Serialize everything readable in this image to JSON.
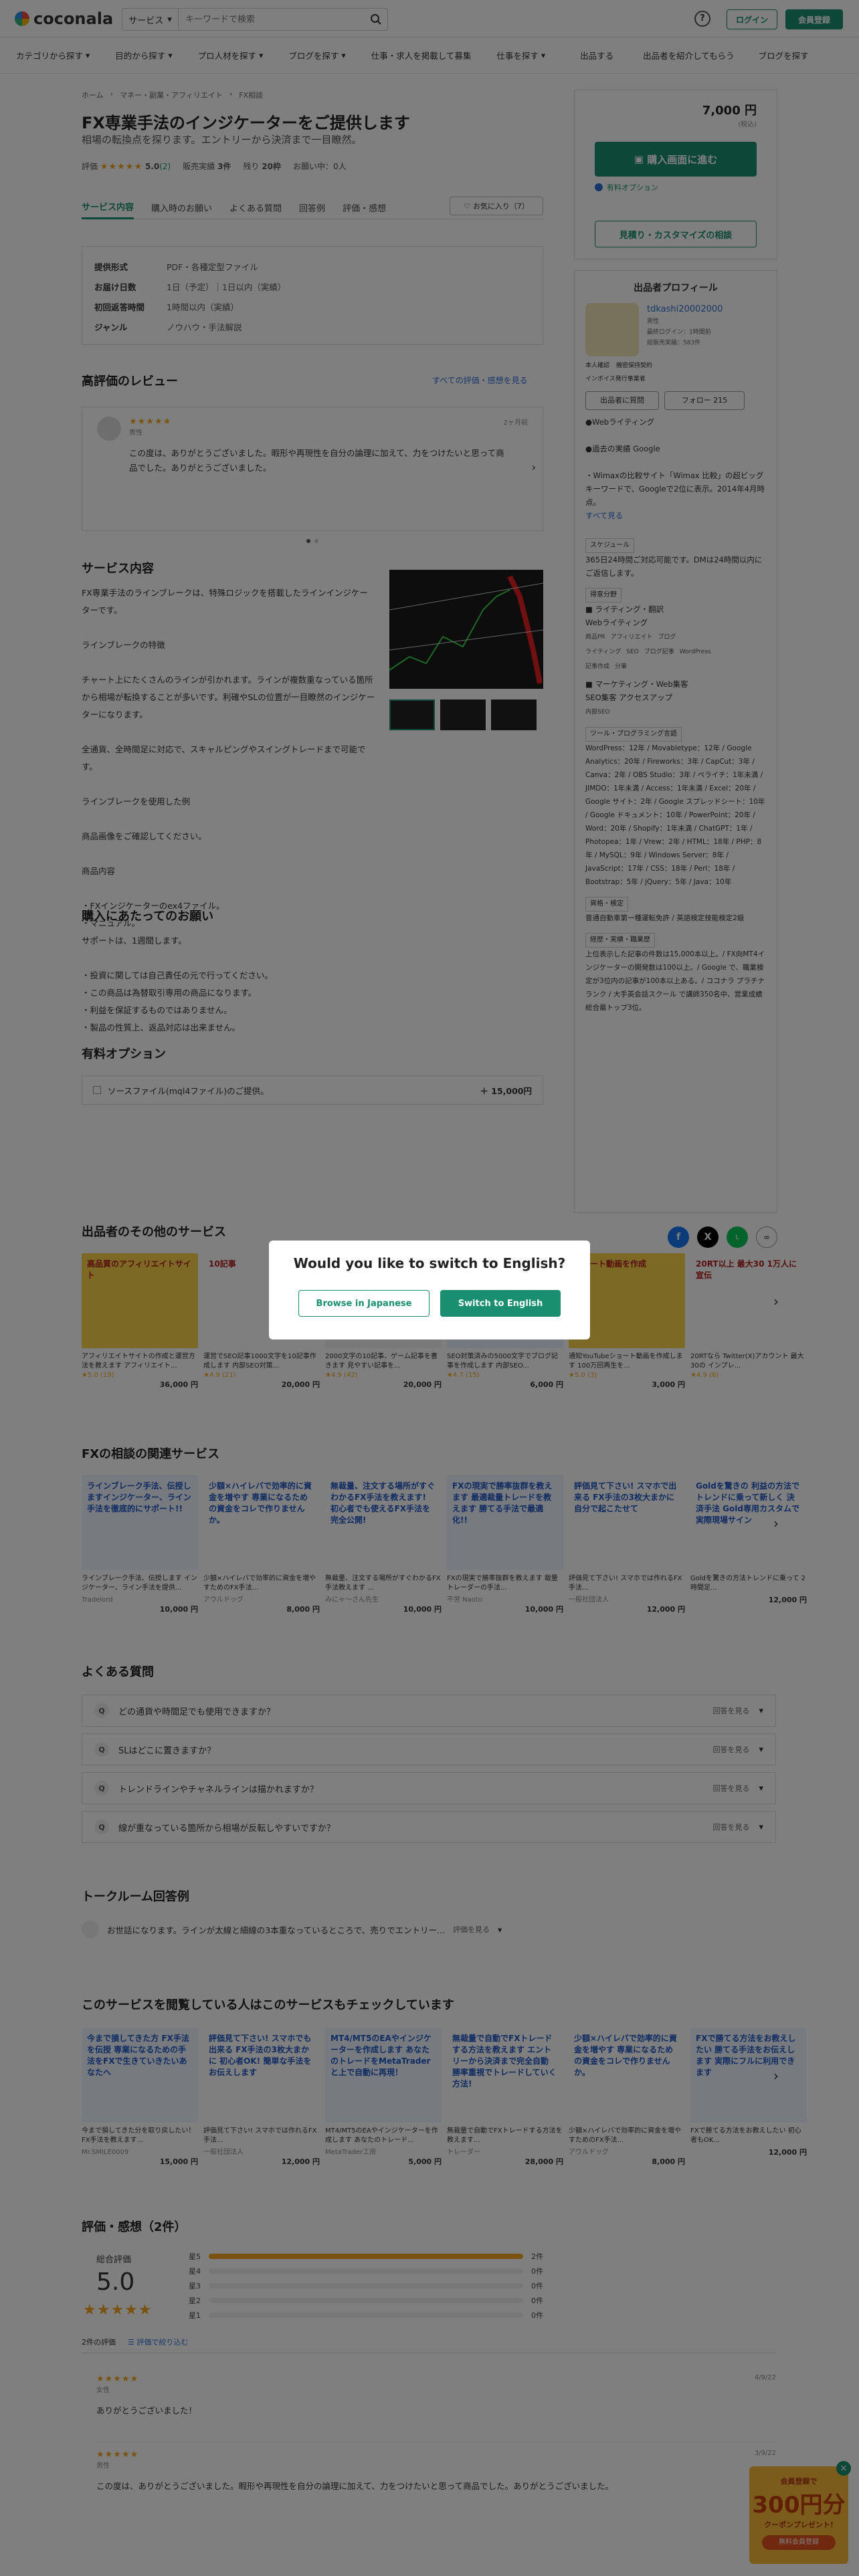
{
  "header": {
    "logo": "coconala",
    "search_select": "サービス",
    "search_placeholder": "キーワードで検索",
    "login": "ログイン",
    "signup": "会員登録"
  },
  "nav": [
    "カテゴリから探す",
    "目的から探す",
    "プロ人材を探す",
    "ブログを探す",
    "仕事・求人を掲載して募集",
    "仕事を探す",
    "出品する",
    "出品者を紹介してもらう",
    "ブログを探す"
  ],
  "breadcrumb": [
    "ホーム",
    "マネー・副業・アフィリエイト",
    "FX相談"
  ],
  "service": {
    "title": "FX専業手法のインジケーターをご提供します",
    "subtitle": "相場の転換点を探ります。エントリーから決済まで一目瞭然。",
    "rating_label": "評価",
    "rating": "5.0",
    "review_count": "(2)",
    "sales_label": "販売実績",
    "sales": "3件",
    "stock_label": "残り",
    "stock": "20枠",
    "in_progress": "お願い中：0人"
  },
  "tabs": [
    "サービス内容",
    "購入時のお願い",
    "よくある質問",
    "回答例",
    "評価・感想"
  ],
  "fav": "お気に入り（7）",
  "spec": [
    {
      "k": "提供形式",
      "v": "PDF・各種定型ファイル"
    },
    {
      "k": "お届け日数",
      "v": "1日（予定）｜1日以内（実績）"
    },
    {
      "k": "初回返答時間",
      "v": "1時間以内（実績）"
    },
    {
      "k": "ジャンル",
      "v": "ノウハウ・手法解説"
    }
  ],
  "reviews": {
    "title": "高評価のレビュー",
    "link": "すべての評価・感想を見る",
    "stars": "★★★★★",
    "user": "男性",
    "date": "2ヶ月前",
    "text": "この度は、ありがとうございました。暇形や再現性を自分の論理に加えて、力をつけたいと思って商品でした。ありがとうございました。"
  },
  "content": {
    "title": "サービス内容",
    "p1": "FX専業手法のラインブレークは、特殊ロジックを搭載したラインインジケーターです。",
    "p2": "ラインブレークの特徴",
    "p3": "チャート上にたくさんのラインが引かれます。ラインが複数重なっている箇所から相場が転換することが多いです。利確やSLの位置が一目瞭然のインジケーターになります。",
    "p4": "全通貨、全時間足に対応で、スキャルピングやスイングトレードまで可能です。",
    "p5": "ラインブレークを使用した例",
    "p6": "商品画像をご確認してください。",
    "p7": "商品内容",
    "p8": "・FXインジケーターのex4ファイル。",
    "p9": "・マニュアル。"
  },
  "notice": {
    "title": "購入にあたってのお願い",
    "lead": "サポートは、1週間します。",
    "lines": [
      "・投資に関しては自己責任の元で行ってください。",
      "・この商品は為替取引専用の商品になります。",
      "・利益を保証するものではありません。",
      "・製品の性質上、返品対応は出来ません。"
    ]
  },
  "options": {
    "title": "有料オプション",
    "item": "ソースファイル(mql4ファイル)のご提供。",
    "price": "＋ 15,000円"
  },
  "sidebar": {
    "price": "7,000 円",
    "price_note": "(税込)",
    "buy": "購入画面に進む",
    "option_link": "有料オプション",
    "estimate": "見積り・カスタマイズの相談",
    "profile_title": "出品者プロフィール",
    "seller": "tdkashi20002000",
    "seller_info": [
      "男性",
      "最終ログイン：1時間前",
      "総販売実績：583件"
    ],
    "verify": [
      "本人確認",
      "機密保持契約"
    ],
    "invoice": "インボイス発行事業者",
    "services_btn": "出品者に質問",
    "follow": "フォロー  215",
    "bio": [
      "●Webライティング",
      "●過去の実績 Google",
      "・Wimaxの比較サイト「Wimax 比較」の超ビッグキーワードで、Googleで2位に表示。2014年4月時点。",
      "すべて見る"
    ],
    "schedule_title": "スケジュール",
    "schedule": "365日24時間ご対応可能です。DMは24時間以内にご返信します。",
    "skills_title": "得意分野",
    "skills": [
      "■ ライティング・翻訳",
      "Webライティング",
      "商品PR",
      "アフィリエイト",
      "ブログ",
      "ライティング",
      "SEO",
      "ブログ記事",
      "WordPress",
      "記事作成",
      "分筆",
      "■ マーケティング・Web集客",
      "SEO集客 アクセスアップ",
      "内部SEO"
    ],
    "tools_title": "ツール・プログラミング言語",
    "tools": "WordPress：12年 / Movabletype：12年 / Google Analytics：20年 / Fireworks：3年 / CapCut：3年 / Canva：2年 / OBS Studio：3年 / ペライチ：1年未満 / JIMDO：1年未満 / Access：1年未満 / Excel：20年 / Google サイト：2年 / Google スプレッドシート：10年 / Google ドキュメント：10年 / PowerPoint：20年 / Word：20年 / Shopify：1年未満 / ChatGPT：1年 / Photopea：1年 / Vrew：2年 / HTML：18年 / PHP：8年 / MySQL：9年 / Windows Server：8年 / JavaScript：17年 / CSS：18年 / Perl：18年 / Bootstrap：5年 / jQuery：5年 / Java：10年",
    "cert_title": "資格・検定",
    "cert": "普通自動車第一種運転免許 / 英語検定技能検定2級",
    "career_title": "経歴・実績・職業歴",
    "career": "上位表示した記事の件数は15,000本以上。/ FX向MT4インジケーターの開発数は100以上。/ Google で、職業検定が3位内の記事が100本以上ある。/ ココナラ プラチナランク / 大手英会話スクール で講師350名中、営業成績総合最トップ3位。"
  },
  "modal": {
    "title": "Would you like to switch to English?",
    "btn_ja": "Browse in Japanese",
    "btn_en": "Switch to English"
  },
  "other_services": {
    "title": "出品者のその他のサービス",
    "items": [
      {
        "t": "アフィリエイトサイトの作成と運営方法を教えます アフィリエイト...",
        "r": "★5.0 (19)",
        "p": "36,000 円",
        "img": "高品質のアフィリエイトサイト"
      },
      {
        "t": "運営でSEO記事1000文字を10記事作成します 内部SEO対策...",
        "r": "★4.9 (21)",
        "p": "20,000 円",
        "img": "10記事"
      },
      {
        "t": "2000文字の10記事、ゲーム記事を書きます 見やすい記事を...",
        "r": "★4.9 (42)",
        "p": "20,000 円",
        "img": ""
      },
      {
        "t": "SEO対策済みの5000文字でブログ記事を作成します 内部SEO...",
        "r": "★4.7 (15)",
        "p": "6,000 円",
        "img": ""
      },
      {
        "t": "通知YouTubeショート動画を作成します 100万回再生を...",
        "r": "★5.0 (3)",
        "p": "3,000 円",
        "img": "ショート動画を作成"
      },
      {
        "t": "20RTなら Twitter(X)アカウント 最大30の インプレ...",
        "r": "★4.9 (6)",
        "p": "",
        "img": "20RT以上 最大30 1万人に宣伝"
      }
    ]
  },
  "related": {
    "title": "FXの相談の関連サービス",
    "items": [
      {
        "t": "ラインブレーク手法、伝授します インジケーター、ライン手法を提供...",
        "u": "Tradelord",
        "p": "10,000 円",
        "img": "ラインブレーク手法、伝授しますインジケーター、ライン手法を徹底的にサポート!!"
      },
      {
        "t": "少額×ハイレバで効率的に資金を増やすためのFX手法...",
        "u": "アウルドッグ",
        "p": "8,000 円",
        "img": "少額×ハイレバで効率的に資金を増やす 専業になるための資金をコレで作りませんか。"
      },
      {
        "t": "無裁量、注文する場所がすぐわかるFX手法教えます ...",
        "u": "みにゃ〜さん先生",
        "p": "10,000 円",
        "img": "無裁量、注文する場所がすぐわかるFX手法を教えます! 初心者でも使えるFX手法を完全公開!"
      },
      {
        "t": "FXの現実で勝率抜群を教えます 裁量トレーダーの手法...",
        "u": "不労 Naoto",
        "p": "10,000 円",
        "img": "FXの現実で勝率抜群を教えます 最適裁量トレードを教えます 勝てる手法で最適化!!"
      },
      {
        "t": "評価見て下さい! スマホでは作れるFX手法...",
        "u": "一般社団法人",
        "p": "12,000 円",
        "img": "評価見て下さい! スマホで出来る FX手法の3枚大まかに自分で起こたせて"
      },
      {
        "t": "Goldを驚きの方法トレンドに乗って 2時間足...",
        "u": "",
        "p": "12,000 円",
        "img": "Goldを驚きの 利益の方法でトレンドに乗って新しく 決済手法 Gold専用カスタムで 実際現場サイン"
      }
    ]
  },
  "faq": {
    "title": "よくある質問",
    "q_label": "Q",
    "items": [
      "どの通貨や時間足でも使用できますか？",
      "SLはどこに置きますか？",
      "トレンドラインやチャネルラインは描かれますか？",
      "線が重なっている箇所から相場が反転しやすいですか？"
    ],
    "more": "回答を見る"
  },
  "talk": {
    "title": "トークルーム回答例",
    "text": "お世話になります。ラインが太線と細線の3本重なっているところで、売りでエントリー...",
    "more": "評価を見る"
  },
  "viewers": {
    "title": "このサービスを閲覧している人はこのサービスもチェックしています",
    "items": [
      {
        "t": "今まで損してきた分を取り戻したい！FX手法を教えます...",
        "u": "Mr.SMILE0009",
        "p": "15,000 円",
        "img": "今まで損してきた方 FX手法を伝授 専業になるための手法をFXで生きていきたいあなたへ"
      },
      {
        "t": "評価見て下さい! スマホでは作れるFX手法...",
        "u": "一般社団法人",
        "p": "12,000 円",
        "img": "評価見て下さい! スマホでも出来る FX手法の3枚大まかに 初心者OK! 簡単な手法をお伝えします"
      },
      {
        "t": "MT4/MT5のEAやインジケーターを作成します あなたのトレード...",
        "u": "MetaTrader工房",
        "p": "5,000 円",
        "img": "MT4/MT5のEAやインジケーターを作成します あなたのトレードをMetaTraderと上で自動に再現！"
      },
      {
        "t": "無裁量で自動でFXトレードする方法を教えます...",
        "u": "トレーダー",
        "p": "28,000 円",
        "img": "無裁量で自動でFXトレードする方法を教えます エントリーから決済まで完全自動 勝率重視でトレードしていく方法!"
      },
      {
        "t": "少額×ハイレバで効率的に資金を増やすためのFX手法...",
        "u": "アウルドッグ",
        "p": "8,000 円",
        "img": "少額×ハイレバで効率的に資金を増やす 専業になるための資金をコレで作りませんか。"
      },
      {
        "t": "FXで勝てる方法をお教えしたい 初心者もOK...",
        "u": "",
        "p": "12,000 円",
        "img": "FXで勝てる方法をお教えしたい 勝てる手法をお伝えします 実際にフルに利用できます"
      }
    ]
  },
  "ratings": {
    "title": "評価・感想（2件）",
    "overall_label": "総合評価",
    "overall": "5.0",
    "stars": "★★★★★",
    "rows": [
      {
        "label": "星5",
        "count": "2件",
        "pct": 1.0
      },
      {
        "label": "星4",
        "count": "0件",
        "pct": 0
      },
      {
        "label": "星3",
        "count": "0件",
        "pct": 0
      },
      {
        "label": "星2",
        "count": "0件",
        "pct": 0
      },
      {
        "label": "星1",
        "count": "0件",
        "pct": 0
      }
    ],
    "count_text": "2件の評価",
    "filter": "評価で絞り込む",
    "reviews": [
      {
        "stars": "★★★★★",
        "user": "女性",
        "date": "4/9/22",
        "text": "ありがとうございました！"
      },
      {
        "stars": "★★★★★",
        "user": "男性",
        "date": "3/9/22",
        "text": "この度は、ありがとうございました。暇形や再現性を自分の論理に加えて、力をつけたいと思って商品でした。ありがとうございました。"
      }
    ]
  },
  "banner": {
    "line1": "会員登録で",
    "line2": "300円分",
    "line3": "クーポンプレゼント!",
    "btn": "無料会員登録"
  },
  "colors": {
    "brand": "#1a8f6f",
    "star": "#f5a623",
    "overlay": "rgba(0,0,0,0.5)"
  }
}
